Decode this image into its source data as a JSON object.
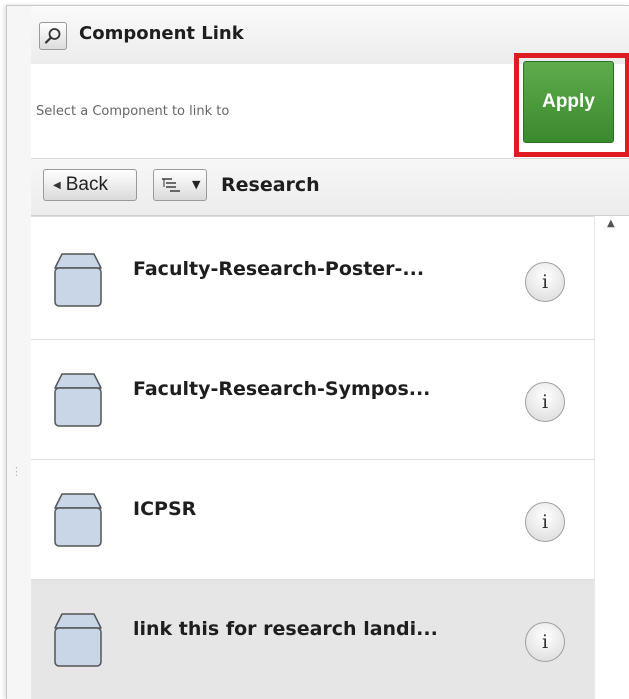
{
  "header": {
    "title": "Component Link",
    "icon": "search-icon"
  },
  "select_row": {
    "text": "Select a Component to link to",
    "apply_label": "Apply",
    "apply_color": "#4a9a3c",
    "highlight_color": "#e01c23"
  },
  "nav": {
    "back_label": "Back",
    "tree_icon": "tree-view-icon",
    "breadcrumb": "Research"
  },
  "list": {
    "items": [
      {
        "label": "Faculty-Research-Poster-...",
        "icon": "component-box-icon",
        "info_label": "i"
      },
      {
        "label": "Faculty-Research-Sympos...",
        "icon": "component-box-icon",
        "info_label": "i"
      },
      {
        "label": "ICPSR",
        "icon": "component-box-icon",
        "info_label": "i"
      },
      {
        "label": "link this for research landi...",
        "icon": "component-box-icon",
        "info_label": "i",
        "selected": true
      }
    ]
  }
}
